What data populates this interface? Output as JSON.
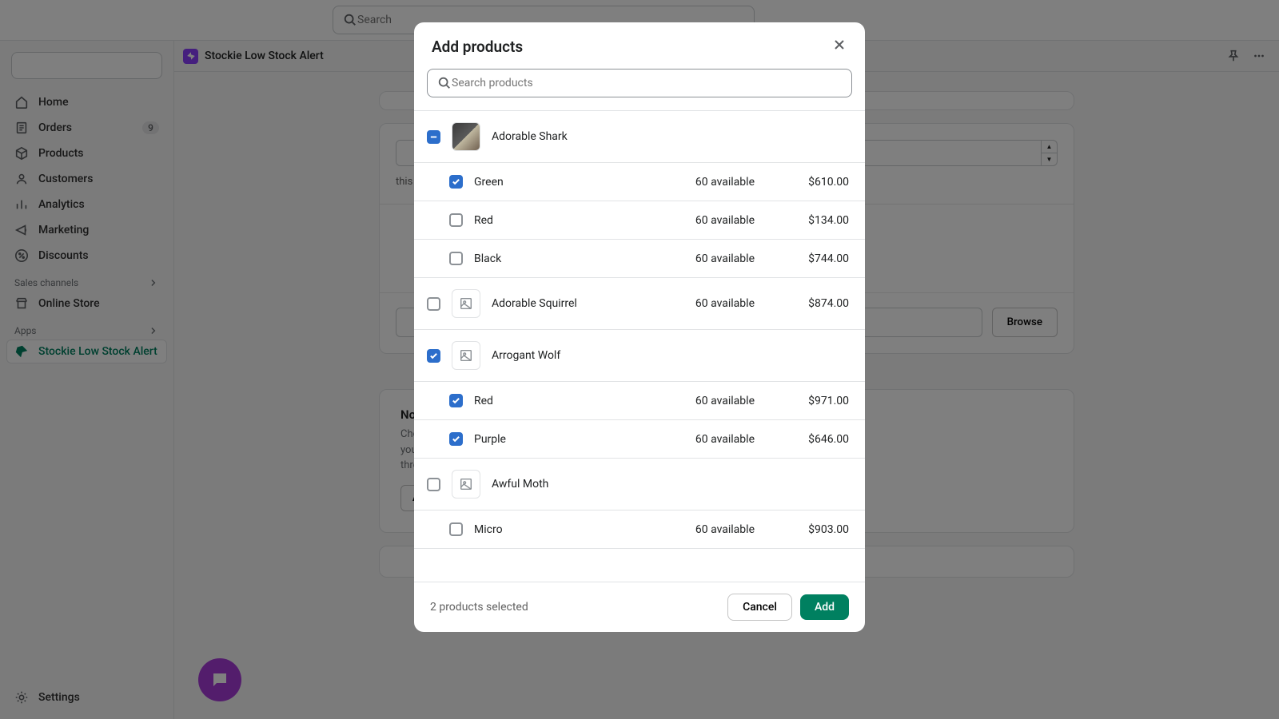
{
  "topbar": {
    "search_placeholder": "Search"
  },
  "sidebar": {
    "items": [
      {
        "label": "Home"
      },
      {
        "label": "Orders",
        "badge": "9"
      },
      {
        "label": "Products"
      },
      {
        "label": "Customers"
      },
      {
        "label": "Analytics"
      },
      {
        "label": "Marketing"
      },
      {
        "label": "Discounts"
      }
    ],
    "sales_label": "Sales channels",
    "online_store": "Online Store",
    "apps_label": "Apps",
    "active_app": "Stockie Low Stock Alert",
    "settings": "Settings"
  },
  "apphdr": {
    "title": "Stockie Low Stock Alert"
  },
  "bg": {
    "hint": "this level.",
    "browse": "Browse",
    "notify_title": "Notif",
    "notify_desc1": "Choose",
    "notify_desc2": "your in",
    "notify_desc3": "thresh",
    "add": "Add"
  },
  "modal": {
    "title": "Add products",
    "search_placeholder": "Search products",
    "products": [
      {
        "name": "Adorable Shark",
        "has_thumb": true,
        "state": "indet",
        "variants": [
          {
            "name": "Green",
            "avail": "60 available",
            "price": "$610.00",
            "state": "checked"
          },
          {
            "name": "Red",
            "avail": "60 available",
            "price": "$134.00",
            "state": ""
          },
          {
            "name": "Black",
            "avail": "60 available",
            "price": "$744.00",
            "state": ""
          }
        ]
      },
      {
        "name": "Adorable Squirrel",
        "has_thumb": false,
        "avail": "60 available",
        "price": "$874.00",
        "state": ""
      },
      {
        "name": "Arrogant Wolf",
        "has_thumb": false,
        "state": "checked",
        "variants": [
          {
            "name": "Red",
            "avail": "60 available",
            "price": "$971.00",
            "state": "checked"
          },
          {
            "name": "Purple",
            "avail": "60 available",
            "price": "$646.00",
            "state": "checked"
          }
        ]
      },
      {
        "name": "Awful Moth",
        "has_thumb": false,
        "state": "",
        "variants": [
          {
            "name": "Micro",
            "avail": "60 available",
            "price": "$903.00",
            "state": ""
          }
        ]
      }
    ],
    "selected_text": "2 products selected",
    "cancel": "Cancel",
    "add": "Add"
  }
}
